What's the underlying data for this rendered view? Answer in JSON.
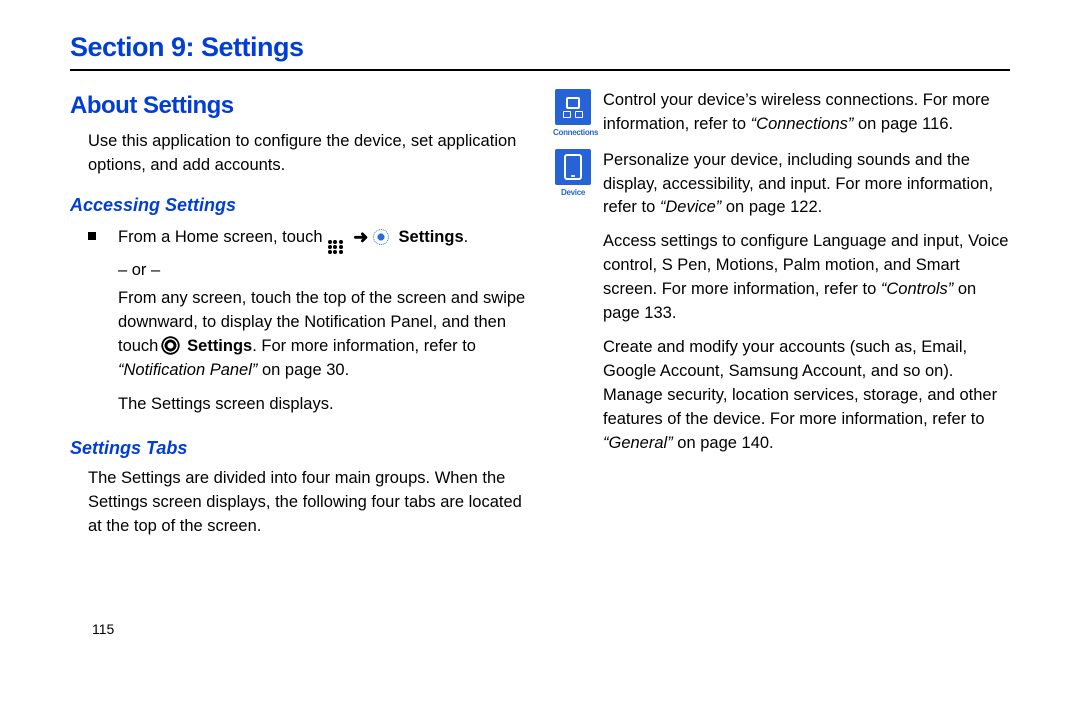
{
  "section_title": "Section 9: Settings",
  "about": {
    "heading": "About Settings",
    "intro": "Use this application to configure the device, set application options, and add accounts."
  },
  "accessing": {
    "heading": "Accessing Settings",
    "line1_a": "From a Home screen, touch ",
    "line1_b": "Settings",
    "line1_c": ".",
    "or": "– or –",
    "line2_a": "From any screen, touch the top of the screen and swipe downward, to display the Notification Panel, and then touch ",
    "line2_b": "Settings",
    "line2_c": ". For more information, refer to ",
    "line2_ref": "“Notification Panel”",
    "line2_d": " on page 30.",
    "line3": "The Settings screen displays."
  },
  "tabs": {
    "heading": "Settings Tabs",
    "intro": "The Settings are divided into four main groups. When the Settings screen displays, the following four tabs are located at the top of the screen."
  },
  "right": {
    "conn_label": "Connections",
    "conn_a": "Control your device’s wireless connections. For more information, refer to ",
    "conn_ref": "“Connections”",
    "conn_b": " on page 116.",
    "dev_label": "Device",
    "dev_a": "Personalize your device, including sounds and the display, accessibility, and input. For more information, refer to ",
    "dev_ref": "“Device”",
    "dev_b": " on page 122.",
    "ctrl_a": "Access settings to configure Language and input, Voice control, S Pen, Motions, Palm motion, and Smart screen. For more information, refer to ",
    "ctrl_ref": "“Controls”",
    "ctrl_b": " on page 133.",
    "gen_a": "Create and modify your accounts (such as, Email, Google Account, Samsung Account, and so on). Manage security, location services, storage, and other features of the device. For more information, refer to ",
    "gen_ref": "“General”",
    "gen_b": " on page 140."
  },
  "page_number": "115"
}
